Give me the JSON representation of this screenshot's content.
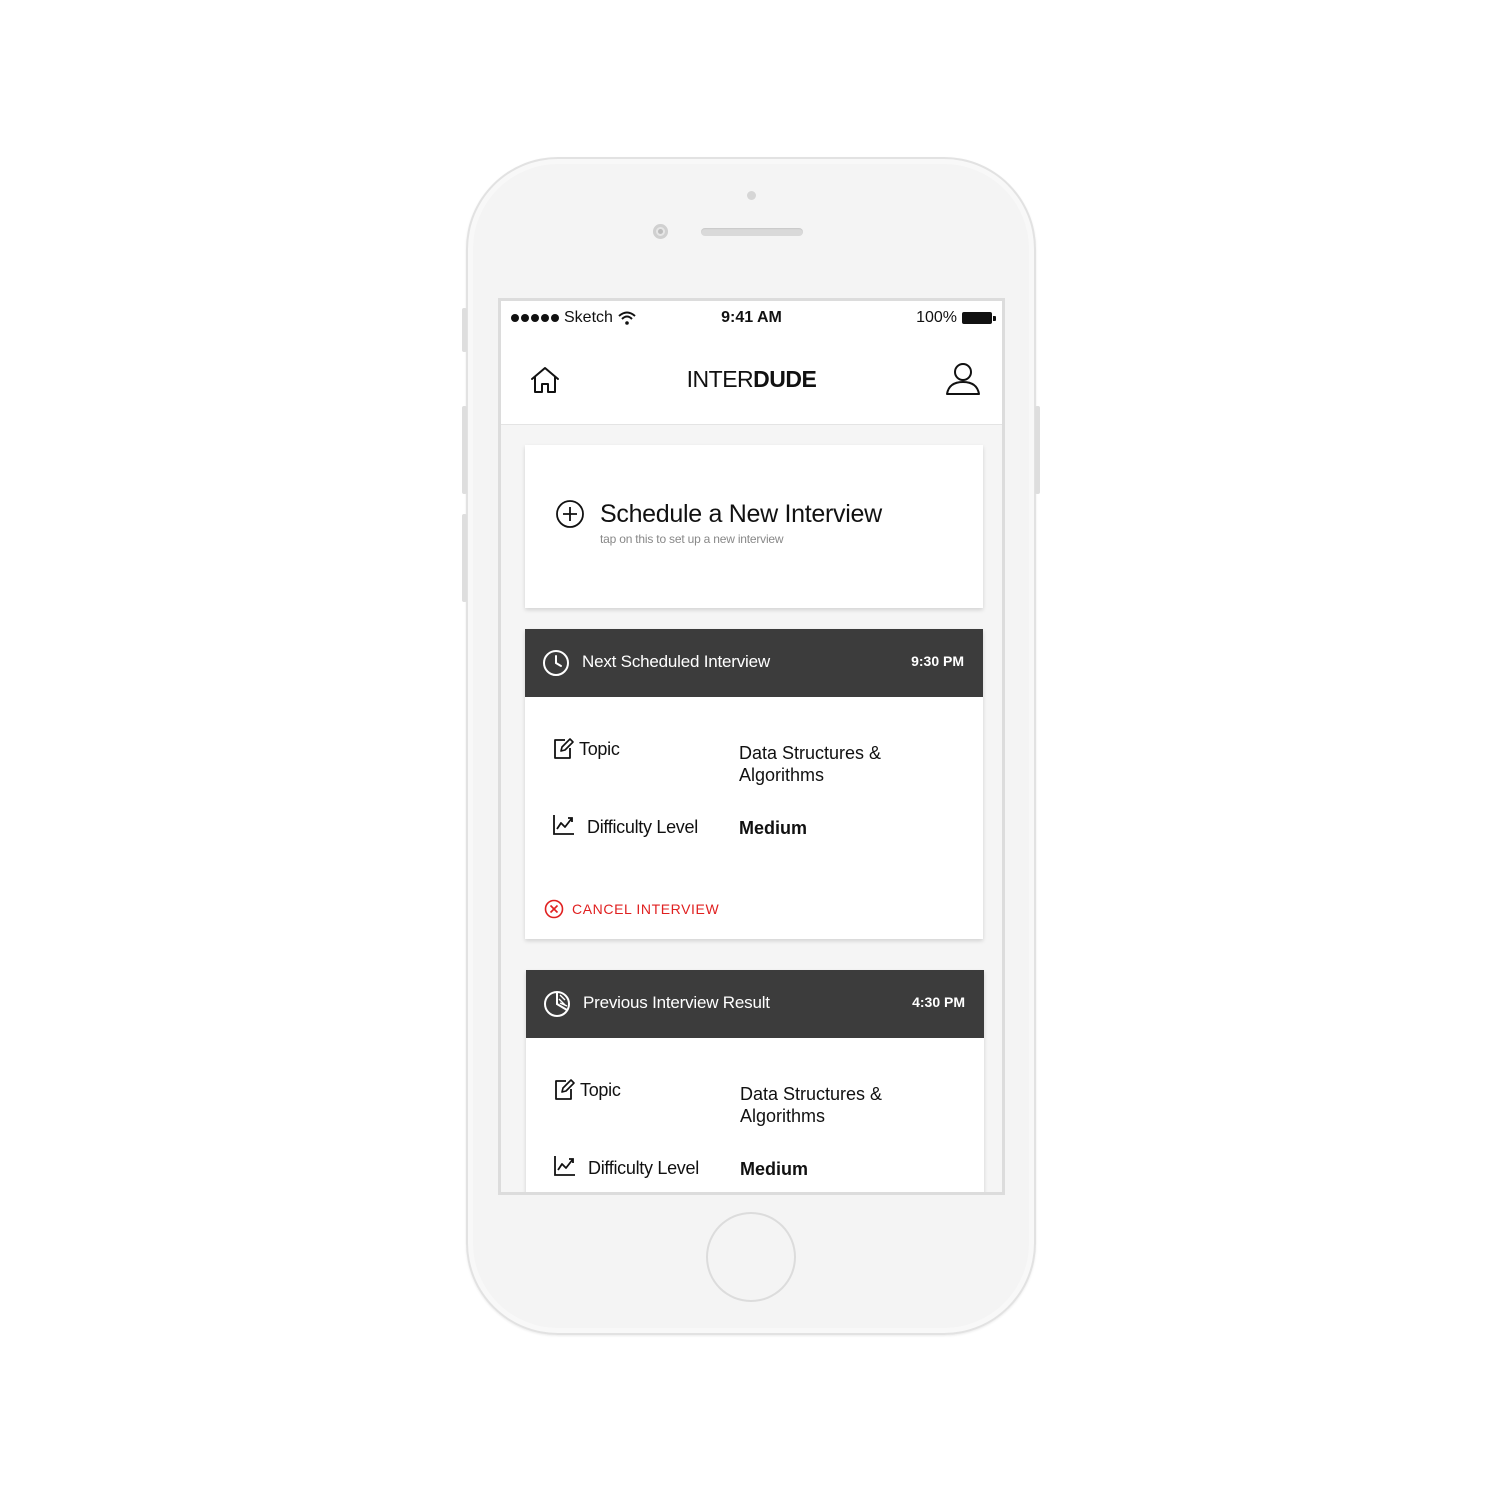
{
  "status_bar": {
    "carrier": "Sketch",
    "time": "9:41 AM",
    "battery": "100%"
  },
  "nav": {
    "brand_light": "INTER",
    "brand_bold": "DUDE",
    "icons": {
      "left": "home-icon",
      "right": "user-icon"
    }
  },
  "schedule": {
    "title": "Schedule a New Interview",
    "subtitle": "tap on this to set up a new interview",
    "icon": "plus-circle-icon"
  },
  "next_interview": {
    "title": "Next Scheduled Interview",
    "time": "9:30 PM",
    "icon": "clock-icon",
    "topic_label": "Topic",
    "topic_value": "Data Structures & Algorithms",
    "difficulty_label": "Difficulty Level",
    "difficulty_value": "Medium",
    "cancel_label": "CANCEL INTERVIEW"
  },
  "previous_interview": {
    "title": "Previous Interview Result",
    "time": "4:30 PM",
    "icon": "pie-chart-icon",
    "topic_label": "Topic",
    "topic_value": "Data Structures & Algorithms",
    "difficulty_label": "Difficulty Level",
    "difficulty_value": "Medium"
  },
  "colors": {
    "header_dark": "#3c3c3c",
    "cancel_red": "#e02020",
    "background": "#f5f5f5"
  }
}
